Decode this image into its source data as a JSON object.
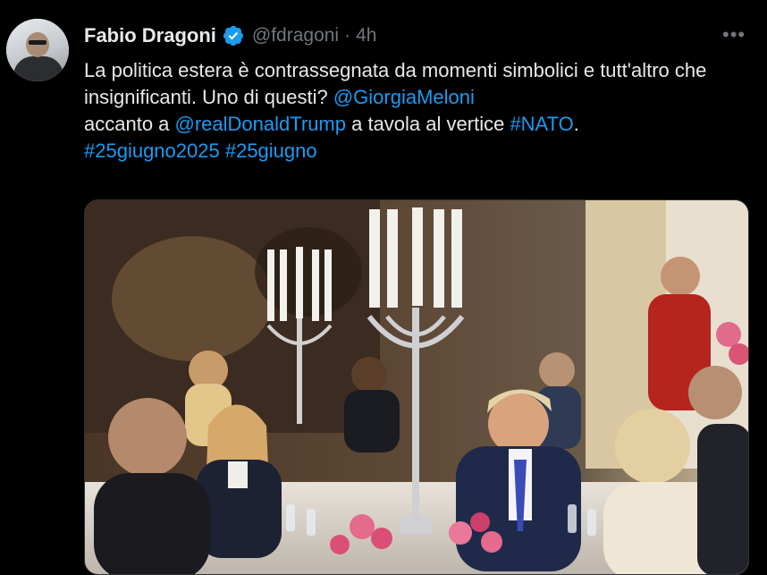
{
  "author": {
    "name": "Fabio Dragoni",
    "handle": "@fdragoni",
    "separator": "·",
    "time": "4h",
    "verified_icon": "verified-badge-icon"
  },
  "menu": {
    "more_label": "•••",
    "icon": "more-options-icon"
  },
  "tweet": {
    "segments": [
      {
        "text": "La politica estera è contrassegnata da momenti simbolici e tutt'altro che insignificanti. Uno di questi? ",
        "type": "text"
      },
      {
        "text": "@GiorgiaMeloni",
        "type": "mention"
      },
      {
        "text": " accanto a ",
        "type": "text"
      },
      {
        "text": "@realDonaldTrump",
        "type": "mention"
      },
      {
        "text": " a tavola al vertice ",
        "type": "text"
      },
      {
        "text": "#NATO",
        "type": "hashtag"
      },
      {
        "text": ". ",
        "type": "text"
      },
      {
        "text": "#25giugno2025",
        "type": "hashtag"
      },
      {
        "text": " ",
        "type": "text"
      },
      {
        "text": "#25giugno",
        "type": "hashtag"
      }
    ]
  },
  "colors": {
    "background": "#000000",
    "text": "#e7e9ea",
    "secondary": "#71767b",
    "link": "#1d9bf0",
    "verified": "#1d9bf0"
  }
}
